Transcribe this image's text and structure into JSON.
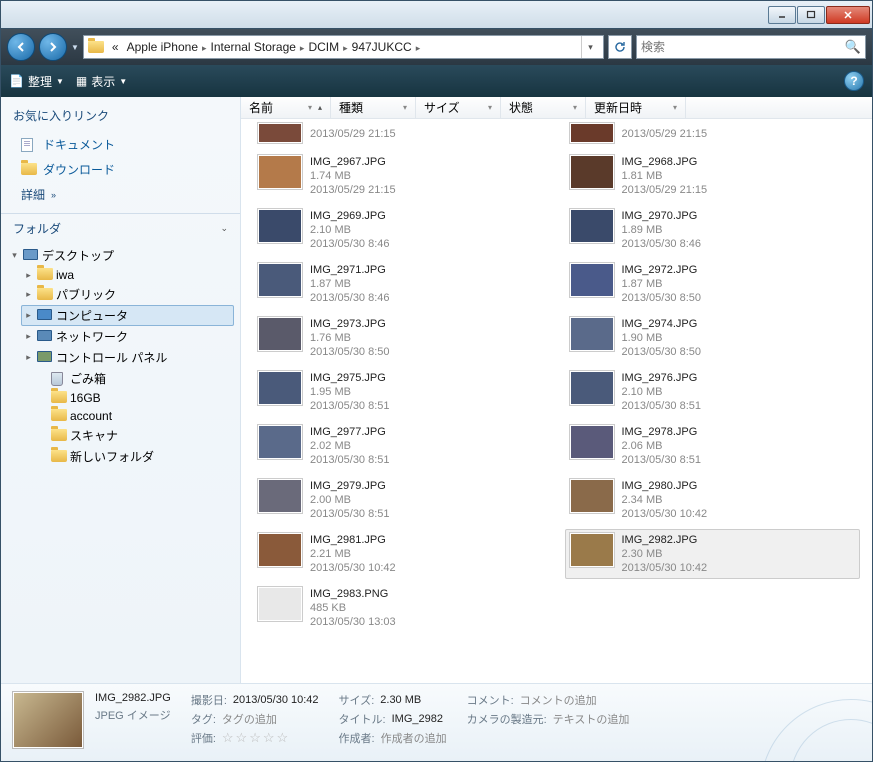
{
  "titlebar": {
    "min": "_",
    "max": "▢",
    "close": "✕"
  },
  "nav": {
    "crumbs_prefix": "«",
    "crumbs": [
      "Apple iPhone",
      "Internal Storage",
      "DCIM",
      "947JUKCC"
    ],
    "search_placeholder": "検索"
  },
  "toolbar": {
    "organize": "整理",
    "view": "表示"
  },
  "sidebar": {
    "fav_title": "お気に入りリンク",
    "fav_links": [
      "ドキュメント",
      "ダウンロード"
    ],
    "more": "詳細",
    "folder_label": "フォルダ",
    "tree": [
      {
        "label": "デスクトップ",
        "icon": "desktop",
        "expanded": true,
        "indent": 0
      },
      {
        "label": "iwa",
        "icon": "folder",
        "expandable": true,
        "indent": 1
      },
      {
        "label": "パブリック",
        "icon": "folder",
        "expandable": true,
        "indent": 1
      },
      {
        "label": "コンピュータ",
        "icon": "monitor",
        "expandable": true,
        "indent": 1,
        "selected": true
      },
      {
        "label": "ネットワーク",
        "icon": "network",
        "expandable": true,
        "indent": 1
      },
      {
        "label": "コントロール パネル",
        "icon": "control",
        "expandable": true,
        "indent": 1
      },
      {
        "label": "ごみ箱",
        "icon": "bin",
        "indent": 2
      },
      {
        "label": "16GB",
        "icon": "folder",
        "indent": 2
      },
      {
        "label": "account",
        "icon": "folder",
        "indent": 2
      },
      {
        "label": "スキャナ",
        "icon": "folder",
        "indent": 2
      },
      {
        "label": "新しいフォルダ",
        "icon": "folder",
        "indent": 2
      }
    ]
  },
  "columns": [
    "名前",
    "種類",
    "サイズ",
    "状態",
    "更新日時"
  ],
  "files_left": [
    {
      "name": "",
      "size": "",
      "date": "2013/05/29 21:15",
      "partial": true,
      "thumb": "#7a4a3a"
    },
    {
      "name": "IMG_2967.JPG",
      "size": "1.74 MB",
      "date": "2013/05/29 21:15",
      "thumb": "#b47a4a"
    },
    {
      "name": "IMG_2969.JPG",
      "size": "2.10 MB",
      "date": "2013/05/30 8:46",
      "thumb": "#3a4a6a"
    },
    {
      "name": "IMG_2971.JPG",
      "size": "1.87 MB",
      "date": "2013/05/30 8:46",
      "thumb": "#4a5a7a"
    },
    {
      "name": "IMG_2973.JPG",
      "size": "1.76 MB",
      "date": "2013/05/30 8:50",
      "thumb": "#5a5a6a"
    },
    {
      "name": "IMG_2975.JPG",
      "size": "1.95 MB",
      "date": "2013/05/30 8:51",
      "thumb": "#4a5a7a"
    },
    {
      "name": "IMG_2977.JPG",
      "size": "2.02 MB",
      "date": "2013/05/30 8:51",
      "thumb": "#5a6a8a"
    },
    {
      "name": "IMG_2979.JPG",
      "size": "2.00 MB",
      "date": "2013/05/30 8:51",
      "thumb": "#6a6a7a"
    },
    {
      "name": "IMG_2981.JPG",
      "size": "2.21 MB",
      "date": "2013/05/30 10:42",
      "thumb": "#8a5a3a"
    },
    {
      "name": "IMG_2983.PNG",
      "size": "485 KB",
      "date": "2013/05/30 13:03",
      "thumb": "#e8e8e8"
    }
  ],
  "files_right": [
    {
      "name": "",
      "size": "",
      "date": "2013/05/29 21:15",
      "partial": true,
      "thumb": "#6a3a2a"
    },
    {
      "name": "IMG_2968.JPG",
      "size": "1.81 MB",
      "date": "2013/05/29 21:15",
      "thumb": "#5a3a2a"
    },
    {
      "name": "IMG_2970.JPG",
      "size": "1.89 MB",
      "date": "2013/05/30 8:46",
      "thumb": "#3a4a6a"
    },
    {
      "name": "IMG_2972.JPG",
      "size": "1.87 MB",
      "date": "2013/05/30 8:50",
      "thumb": "#4a5a8a"
    },
    {
      "name": "IMG_2974.JPG",
      "size": "1.90 MB",
      "date": "2013/05/30 8:50",
      "thumb": "#5a6a8a"
    },
    {
      "name": "IMG_2976.JPG",
      "size": "2.10 MB",
      "date": "2013/05/30 8:51",
      "thumb": "#4a5a7a"
    },
    {
      "name": "IMG_2978.JPG",
      "size": "2.06 MB",
      "date": "2013/05/30 8:51",
      "thumb": "#5a5a7a"
    },
    {
      "name": "IMG_2980.JPG",
      "size": "2.34 MB",
      "date": "2013/05/30 10:42",
      "thumb": "#8a6a4a"
    },
    {
      "name": "IMG_2982.JPG",
      "size": "2.30 MB",
      "date": "2013/05/30 10:42",
      "selected": true,
      "thumb": "#9a7a4a"
    }
  ],
  "details": {
    "filename": "IMG_2982.JPG",
    "filetype": "JPEG イメージ",
    "labels": {
      "shot_date": "撮影日:",
      "tags": "タグ:",
      "rating": "評価:",
      "size": "サイズ:",
      "title": "タイトル:",
      "author": "作成者:",
      "comment": "コメント:",
      "camera": "カメラの製造元:"
    },
    "shot_date": "2013/05/30 10:42",
    "tags": "タグの追加",
    "size": "2.30 MB",
    "title": "IMG_2982",
    "author": "作成者の追加",
    "comment": "コメントの追加",
    "camera": "テキストの追加"
  }
}
